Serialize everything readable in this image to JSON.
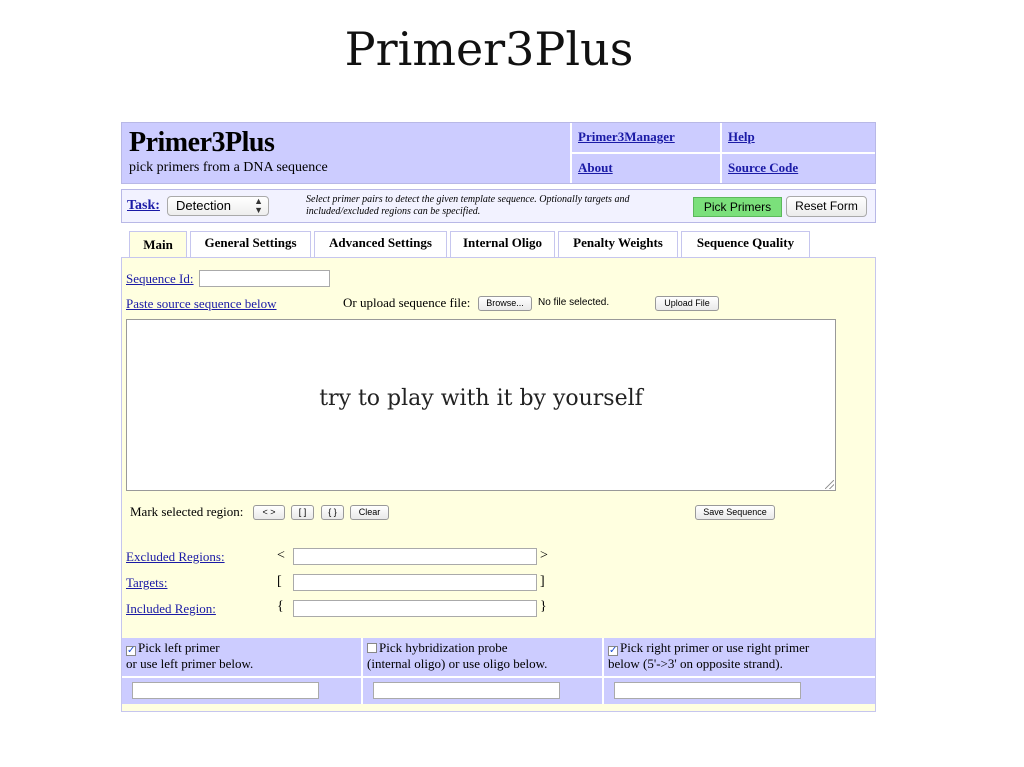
{
  "slide": {
    "title": "Primer3Plus"
  },
  "header": {
    "brand": "Primer3Plus",
    "tagline": "pick primers from a DNA sequence",
    "links": [
      "Primer3Manager",
      "Help",
      "About",
      "Source Code"
    ]
  },
  "task": {
    "label": "Task:",
    "selected": "Detection",
    "description": "Select primer pairs to detect the given template sequence. Optionally targets and included/excluded regions can be specified.",
    "pick_label": "Pick Primers",
    "reset_label": "Reset Form"
  },
  "tabs": [
    "Main",
    "General Settings",
    "Advanced Settings",
    "Internal Oligo",
    "Penalty Weights",
    "Sequence Quality"
  ],
  "main": {
    "sequence_id_label": "Sequence Id:",
    "paste_label": "Paste source sequence below",
    "upload_label": "Or upload sequence file:",
    "browse_label": "Browse...",
    "no_file": "No file selected.",
    "upload_button": "Upload File",
    "overlay_text": "try to play with it by yourself",
    "mark_label": "Mark selected region:",
    "mark_buttons": [
      "< >",
      "[ ]",
      "{ }",
      "Clear"
    ],
    "save_button": "Save Sequence",
    "regions": [
      {
        "label": "Excluded Regions:",
        "open": "<",
        "close": ">"
      },
      {
        "label": "Targets:",
        "open": "[",
        "close": "]"
      },
      {
        "label": "Included Region:",
        "open": "{",
        "close": "}"
      }
    ]
  },
  "checks": [
    {
      "line1": "Pick left primer",
      "line2": "or use left primer below.",
      "checked": true
    },
    {
      "line1": "Pick hybridization probe",
      "line2": "(internal oligo) or use oligo below.",
      "checked": false
    },
    {
      "line1": "Pick right primer or use right primer",
      "line2": "below (5'->3' on opposite strand).",
      "checked": true
    }
  ]
}
